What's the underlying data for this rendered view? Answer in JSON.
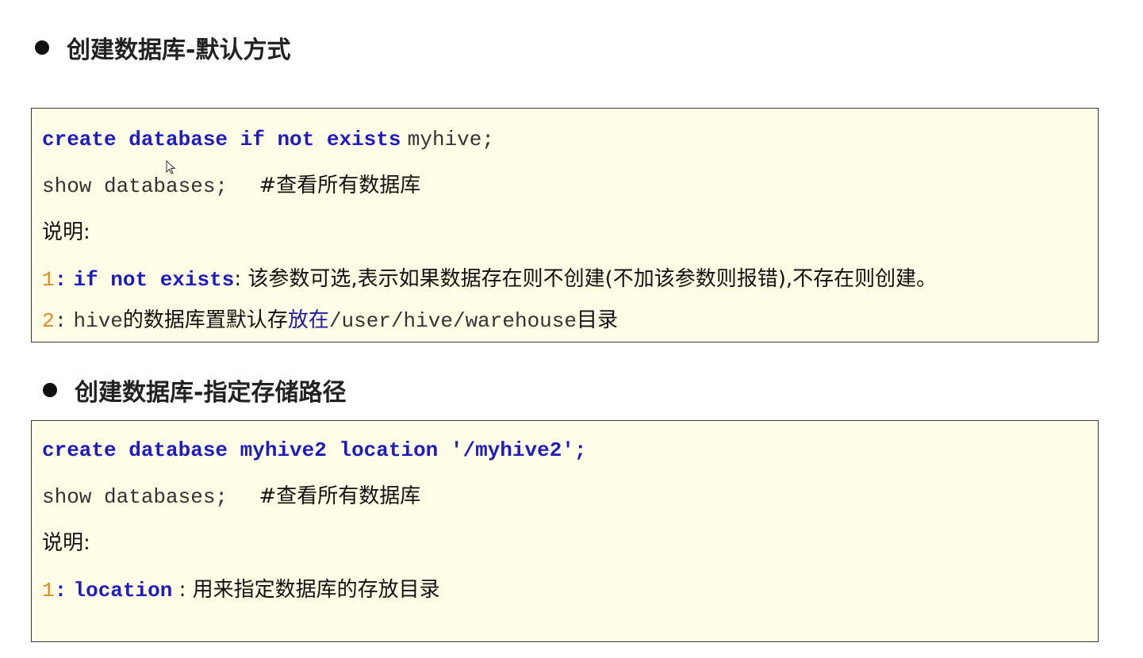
{
  "section1": {
    "heading": "创建数据库-默认方式",
    "code": {
      "line1_keywords": "create database if not exists",
      "line1_name": "myhive;",
      "line2_code": "show databases;  ",
      "line2_comment": "#查看所有数据库",
      "note_label": "说明:",
      "note1_num": "1",
      "note1_colon": ":",
      "note1_keywords": "if not exists",
      "note1_text": ": 该参数可选,表示如果数据存在则不创建(不加该参数则报错),不存在则创建。",
      "note2_num": "2",
      "note2_colon": ":",
      "note2_code1": "hive",
      "note2_text1": "的数据库置默认存",
      "note2_text_blue": "放在",
      "note2_path": "/user/hive/warehouse",
      "note2_text2": "目录"
    }
  },
  "section2": {
    "heading": "创建数据库-指定存储路径",
    "code": {
      "line1": "create database myhive2 location '/myhive2';",
      "line2_code": "show databases;  ",
      "line2_comment": "#查看所有数据库",
      "note_label": "说明:",
      "note1_num": "1",
      "note1_colon": ":",
      "note1_keyword": "location",
      "note1_text": " : 用来指定数据库的存放目录"
    }
  },
  "icons": {
    "cursor": "mouse-pointer-icon",
    "bullet": "bullet-dot-icon"
  },
  "colors": {
    "keyword": "#1c1cc0",
    "number": "#e08a1e",
    "code_background": "#fffde6"
  }
}
